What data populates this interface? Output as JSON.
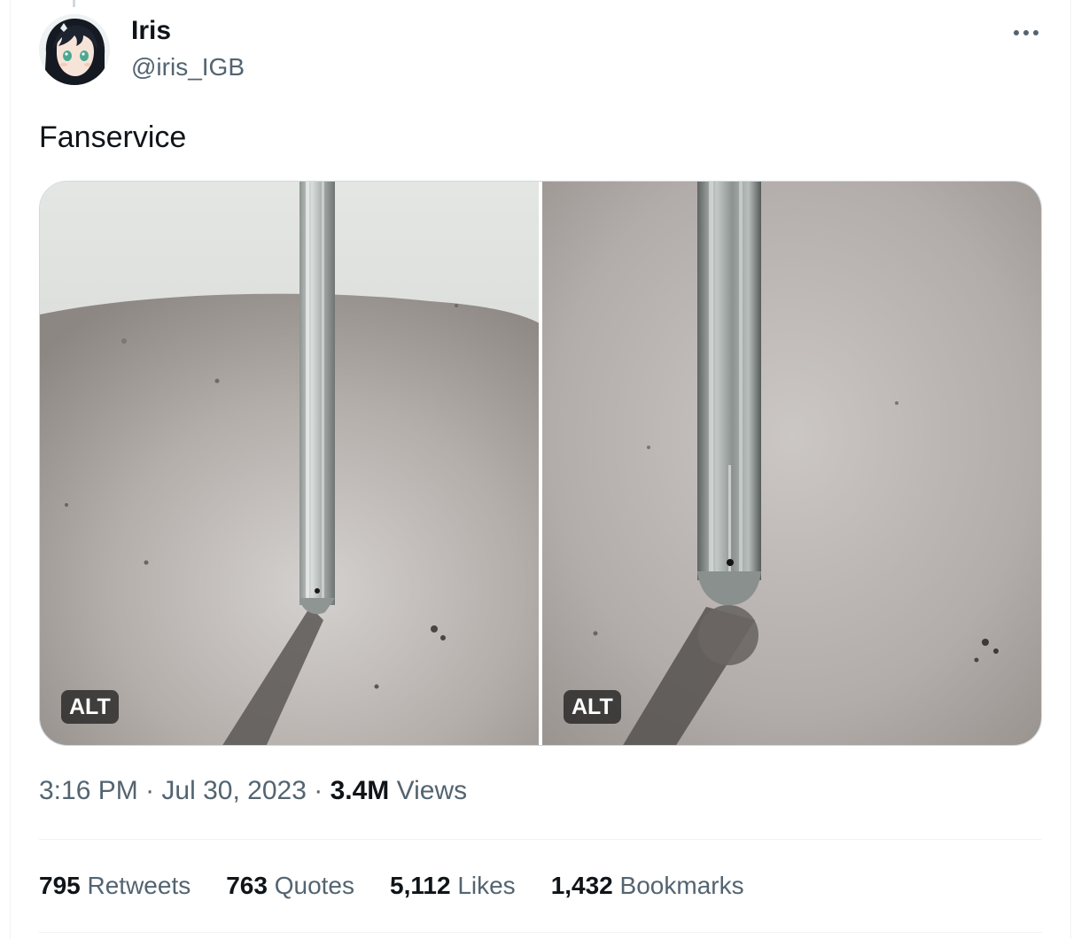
{
  "tweet": {
    "author_name": "Iris",
    "author_handle": "@iris_IGB",
    "more_icon": "ellipsis-icon",
    "text": "Fanservice",
    "media": [
      {
        "alt_label": "ALT"
      },
      {
        "alt_label": "ALT"
      }
    ],
    "time": "3:16 PM",
    "date": "Jul 30, 2023",
    "separator": "·",
    "views_count": "3.4M",
    "views_label": "Views"
  },
  "stats": [
    {
      "count": "795",
      "label": "Retweets"
    },
    {
      "count": "763",
      "label": "Quotes"
    },
    {
      "count": "5,112",
      "label": "Likes"
    },
    {
      "count": "1,432",
      "label": "Bookmarks"
    }
  ],
  "colors": {
    "text_primary": "#0f1419",
    "text_secondary": "#536471",
    "border": "#eff3f4"
  }
}
